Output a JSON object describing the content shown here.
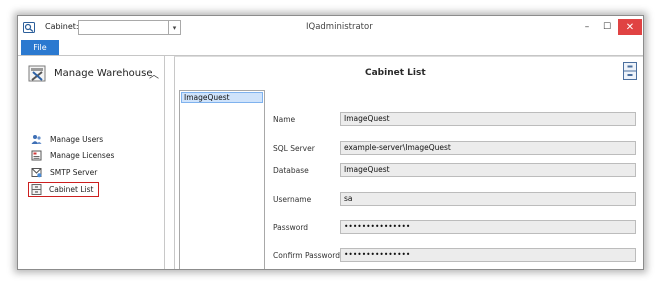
{
  "titlebar": {
    "cabinet_label": "Cabinet:",
    "cabinet_value": "",
    "app_title": "IQadministrator",
    "minimize_glyph": "–",
    "maximize_glyph": "☐",
    "close_glyph": "✕"
  },
  "ribbon": {
    "file_tab": "File"
  },
  "nav": {
    "section_title": "Manage Warehouse",
    "items": [
      {
        "label": "Manage Users",
        "icon": "users-icon"
      },
      {
        "label": "Manage Licenses",
        "icon": "license-icon"
      },
      {
        "label": "SMTP Server",
        "icon": "smtp-icon"
      },
      {
        "label": "Cabinet List",
        "icon": "cabinet-icon",
        "selected": true
      }
    ]
  },
  "content": {
    "title": "Cabinet List",
    "cabinets": [
      "ImageQuest"
    ],
    "fields": {
      "name": {
        "label": "Name",
        "value": "ImageQuest"
      },
      "sql_server": {
        "label": "SQL Server",
        "value": "example-server\\ImageQuest"
      },
      "database": {
        "label": "Database",
        "value": "ImageQuest"
      },
      "username": {
        "label": "Username",
        "value": "sa"
      },
      "password": {
        "label": "Password",
        "value": "•••••••••••••••"
      },
      "confirm_password": {
        "label": "Confirm Password",
        "value": "•••••••••••••••"
      }
    }
  },
  "colors": {
    "accent": "#2b79d0",
    "close": "#e04343",
    "highlight_border": "#cc1f1f",
    "selection": "#cfe3fb"
  }
}
